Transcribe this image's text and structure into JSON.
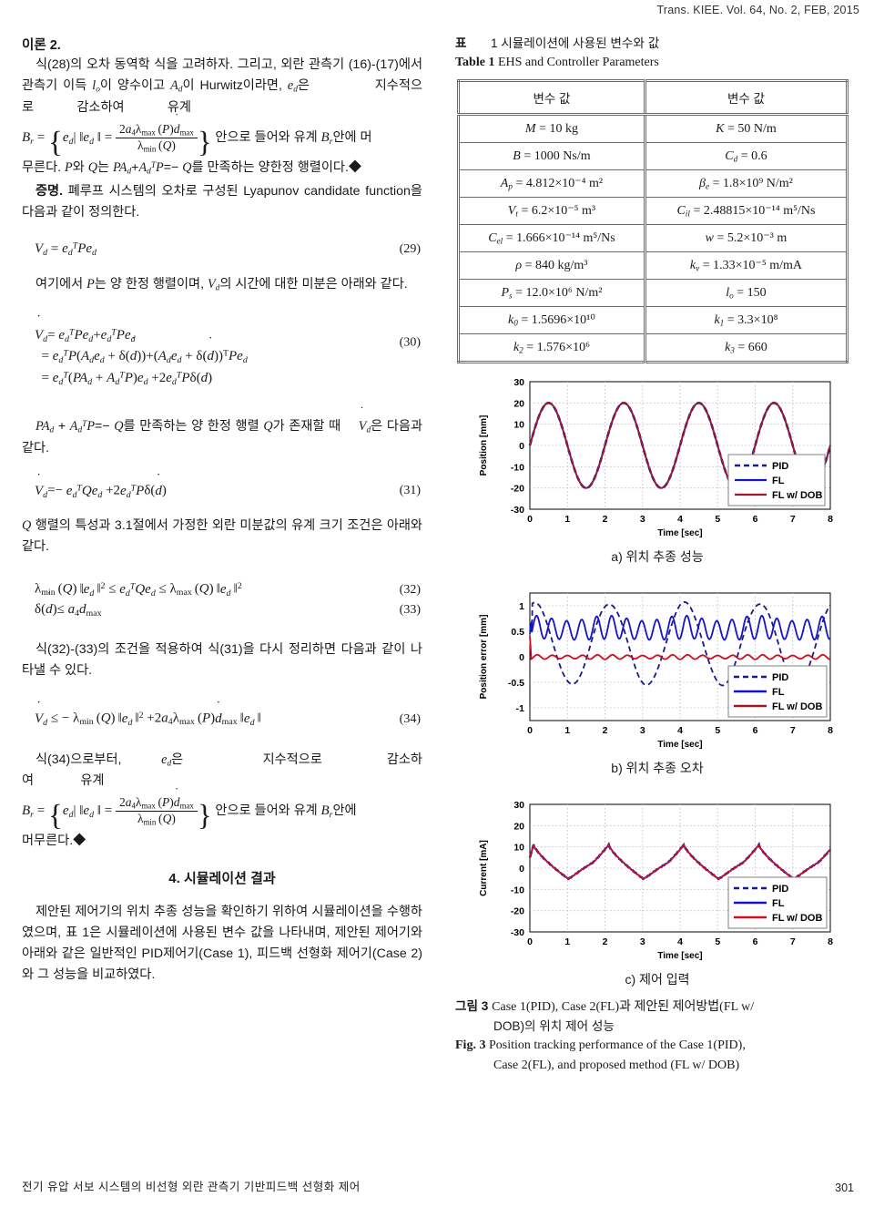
{
  "runhead": "Trans. KIEE. Vol. 64, No. 2, FEB, 2015",
  "left": {
    "theorem_label": "이론 2.",
    "p1": "식(28)의 오차 동역학 식을 고려하자. 그리고, 외란 관측기 (16)-(17)에서 관측기 이득 lo이 양수이고 Ad이 Hurwitz이라면, ed은 지수적으로 감소하여 유계",
    "p1_tail": "안으로 들어와 유계 Br안에 머무른다. P와 Q는 PAd+AdᵀP=−Q를 만족하는 양한정 행렬이다.◆",
    "proof_label": "증명.",
    "p2": "폐루프 시스템의 오차로 구성된 Lyapunov candidate function을 다음과 같이 정의한다.",
    "eq29_no": "(29)",
    "p3": "여기에서 P는 양 한정 행렬이며, Vd의 시간에 대한 미분은 아래와 같다.",
    "eq30_no": "(30)",
    "p4": "PAd+AdᵀP=−Q를 만족하는 양 한정 행렬 Q가 존재할 때 V̇d은 다음과 같다.",
    "eq31_no": "(31)",
    "p5": "Q 행렬의 특성과 3.1절에서 가정한 외란 미분값의 유계 크기 조건은 아래와 같다.",
    "eq32_no": "(32)",
    "eq33_no": "(33)",
    "p6": "식(32)-(33)의 조건을 적용하여 식(31)을 다시 정리하면 다음과 같이 나타낼 수 있다.",
    "eq34_no": "(34)",
    "p7_a": "식(34)으로부터,",
    "p7_b": "ed은",
    "p7_c": "지수적으로",
    "p7_d": "감소하여",
    "p7_e": "유계",
    "p7_tail": "안으로 들어와 유계 Br안에",
    "p7_end": "머무른다.◆",
    "section_head": "4. 시뮬레이션 결과",
    "p8": "제안된 제어기의 위치 추종 성능을 확인하기 위하여 시뮬레이션을 수행하였으며, 표 1은 시뮬레이션에 사용된 변수 값을 나타내며, 제안된 제어기와 아래와 같은 일반적인 PID제어기(Case 1), 피드백 선형화 제어기(Case 2)와 그 성능을 비교하였다."
  },
  "table": {
    "caption_ko_label": "표",
    "caption_ko_num": "1",
    "caption_ko_text": "시뮬레이션에 사용된 변수와 값",
    "caption_en_label": "Table",
    "caption_en_num": "1",
    "caption_en_text": "EHS and Controller Parameters",
    "header_left": "변수 값",
    "header_right": "변수 값",
    "rows": [
      {
        "left": {
          "sym": "M",
          "sub": "",
          "eq": "=",
          "val": "10",
          "unit": "kg"
        },
        "right": {
          "sym": "K",
          "sub": "",
          "eq": "=",
          "val": "50",
          "unit": "N/m"
        }
      },
      {
        "left": {
          "sym": "B",
          "sub": "",
          "eq": "=",
          "val": "1000",
          "unit": "Ns/m"
        },
        "right": {
          "sym": "C",
          "sub": "d",
          "eq": "=",
          "val": "0.6",
          "unit": ""
        }
      },
      {
        "left": {
          "sym": "A",
          "sub": "p",
          "eq": "=",
          "val": "4.812×10⁻⁴",
          "unit": "m²"
        },
        "right": {
          "sym": "β",
          "sub": "e",
          "eq": "=",
          "val": "1.8×10⁹",
          "unit": "N/m²"
        }
      },
      {
        "left": {
          "sym": "V",
          "sub": "t",
          "eq": "=",
          "val": "6.2×10⁻⁵",
          "unit": "m³"
        },
        "right": {
          "sym": "C",
          "sub": "il",
          "eq": "=",
          "val": "2.48815×10⁻¹⁴",
          "unit": "m⁵/Ns"
        }
      },
      {
        "left": {
          "sym": "C",
          "sub": "el",
          "eq": "=",
          "val": "1.666×10⁻¹⁴",
          "unit": "m⁵/Ns"
        },
        "right": {
          "sym": "w",
          "sub": "",
          "eq": "=",
          "val": "5.2×10⁻³",
          "unit": "m"
        }
      },
      {
        "left": {
          "sym": "ρ",
          "sub": "",
          "eq": "=",
          "val": "840",
          "unit": "kg/m³"
        },
        "right": {
          "sym": "k",
          "sub": "v",
          "eq": "=",
          "val": "1.33×10⁻⁵",
          "unit": "m/mA"
        }
      },
      {
        "left": {
          "sym": "P",
          "sub": "s",
          "eq": "=",
          "val": "12.0×10⁶",
          "unit": "N/m²"
        },
        "right": {
          "sym": "l",
          "sub": "o",
          "eq": "=",
          "val": "150",
          "unit": ""
        }
      },
      {
        "left": {
          "sym": "k",
          "sub": "0",
          "eq": "=",
          "val": "1.5696×10¹⁰",
          "unit": ""
        },
        "right": {
          "sym": "k",
          "sub": "1",
          "eq": "=",
          "val": "3.3×10⁸",
          "unit": ""
        }
      },
      {
        "left": {
          "sym": "k",
          "sub": "2",
          "eq": "=",
          "val": "1.576×10⁶",
          "unit": ""
        },
        "right": {
          "sym": "k",
          "sub": "3",
          "eq": "=",
          "val": "660",
          "unit": ""
        }
      }
    ]
  },
  "figure": {
    "sub_a": "a) 위치 추종 성능",
    "sub_b": "b) 위치 추종 오차",
    "sub_c": "c) 제어 입력",
    "cap_ko_label": "그림",
    "cap_ko_num": "3",
    "cap_ko_line1": "Case 1(PID), Case 2(FL)과 제안된 제어방법(FL w/",
    "cap_ko_line2": "DOB)의 위치 제어 성능",
    "cap_en_label": "Fig.",
    "cap_en_num": "3",
    "cap_en_line1": "Position tracking performance of the Case 1(PID),",
    "cap_en_line2": "Case 2(FL), and proposed method (FL w/ DOB)"
  },
  "colors": {
    "pid": "#1a1a8c",
    "fl": "#1414cc",
    "fldob": "#a01828",
    "grid": "#bdbdbd",
    "axis": "#000000"
  },
  "footer": {
    "running_title": "전기 유압 서보 시스템의 비선형 외란 관측기 기반피드백 선형화 제어",
    "page_number": "301"
  },
  "chart_data": [
    {
      "type": "line",
      "id": "a",
      "title": "a) 위치 추종 성능",
      "xlabel": "Time [sec]",
      "ylabel": "Position [mm]",
      "xlim": [
        0,
        8
      ],
      "ylim": [
        -30,
        30
      ],
      "xticks": [
        0,
        1,
        2,
        3,
        4,
        5,
        6,
        7,
        8
      ],
      "yticks": [
        -30,
        -20,
        -10,
        0,
        10,
        20,
        30
      ],
      "grid": true,
      "legend": [
        "PID",
        "FL",
        "FL w/ DOB"
      ],
      "legend_position": "lower-right",
      "description": "All three curves overlap: sinusoid amplitude 20 mm, period 2 s, starting at 0 rising first.",
      "series": [
        {
          "name": "PID",
          "style": "dashed",
          "color": "#1a1a8c",
          "waveform": "20*sin(pi*t)",
          "amplitude": 20,
          "period": 2,
          "phase": 0
        },
        {
          "name": "FL",
          "style": "solid",
          "color": "#1414cc",
          "waveform": "20*sin(pi*t)",
          "amplitude": 20,
          "period": 2,
          "phase": 0
        },
        {
          "name": "FL w/ DOB",
          "style": "solid",
          "color": "#a01828",
          "waveform": "20*sin(pi*t)",
          "amplitude": 20,
          "period": 2,
          "phase": 0
        }
      ]
    },
    {
      "type": "line",
      "id": "b",
      "title": "b) 위치 추종 오차",
      "xlabel": "Time [sec]",
      "ylabel": "Position error [mm]",
      "xlim": [
        0,
        8
      ],
      "ylim": [
        -1.25,
        1.25
      ],
      "xticks": [
        0,
        1,
        2,
        3,
        4,
        5,
        6,
        7,
        8
      ],
      "yticks": [
        -1,
        -0.5,
        0,
        0.5,
        1
      ],
      "grid": true,
      "legend": [
        "PID",
        "FL",
        "FL w/ DOB"
      ],
      "legend_position": "lower-right",
      "description": "PID dashed swings from -0.55 to +1.05 with 2 s period; FL solid blue oscillates 0.32 to 0.78 at ~2.5 Hz; FL w/DOB red stays near 0 with small +/-0.06 ripple after an initial spike of 0.4.",
      "series": [
        {
          "name": "PID",
          "style": "dashed",
          "color": "#1a1a8c",
          "min": -0.55,
          "max": 1.05,
          "period": 2,
          "mean": 0.25
        },
        {
          "name": "FL",
          "style": "solid",
          "color": "#1414cc",
          "min": 0.32,
          "max": 0.78,
          "period": 0.4,
          "mean": 0.55
        },
        {
          "name": "FL w/ DOB",
          "style": "solid",
          "color": "#a01828",
          "min": -0.06,
          "max": 0.06,
          "period": 0.4,
          "mean": 0.0,
          "initial_spike": 0.4
        }
      ]
    },
    {
      "type": "line",
      "id": "c",
      "title": "c) 제어 입력",
      "xlabel": "Time [sec]",
      "ylabel": "Current [mA]",
      "xlim": [
        0,
        8
      ],
      "ylim": [
        -30,
        30
      ],
      "xticks": [
        0,
        1,
        2,
        3,
        4,
        5,
        6,
        7,
        8
      ],
      "yticks": [
        -30,
        -20,
        -10,
        0,
        10,
        20,
        30
      ],
      "grid": true,
      "legend": [
        "PID",
        "FL",
        "FL w/ DOB"
      ],
      "legend_position": "lower-right",
      "description": "All three curves overlap: sawtooth-like wave peaking at about 11 mA near t=0.1, 2.1, 4.1, 6.1 and dipping to about -5 mA near t=1, 3, 5, 7; period 2 s with a small shoulder near the rise.",
      "series": [
        {
          "name": "PID",
          "style": "dashed",
          "color": "#1a1a8c",
          "peak": 11,
          "trough": -5,
          "period": 2
        },
        {
          "name": "FL",
          "style": "solid",
          "color": "#1414cc",
          "peak": 11,
          "trough": -5,
          "period": 2
        },
        {
          "name": "FL w/ DOB",
          "style": "solid",
          "color": "#a01828",
          "peak": 11,
          "trough": -5,
          "period": 2
        }
      ]
    }
  ]
}
